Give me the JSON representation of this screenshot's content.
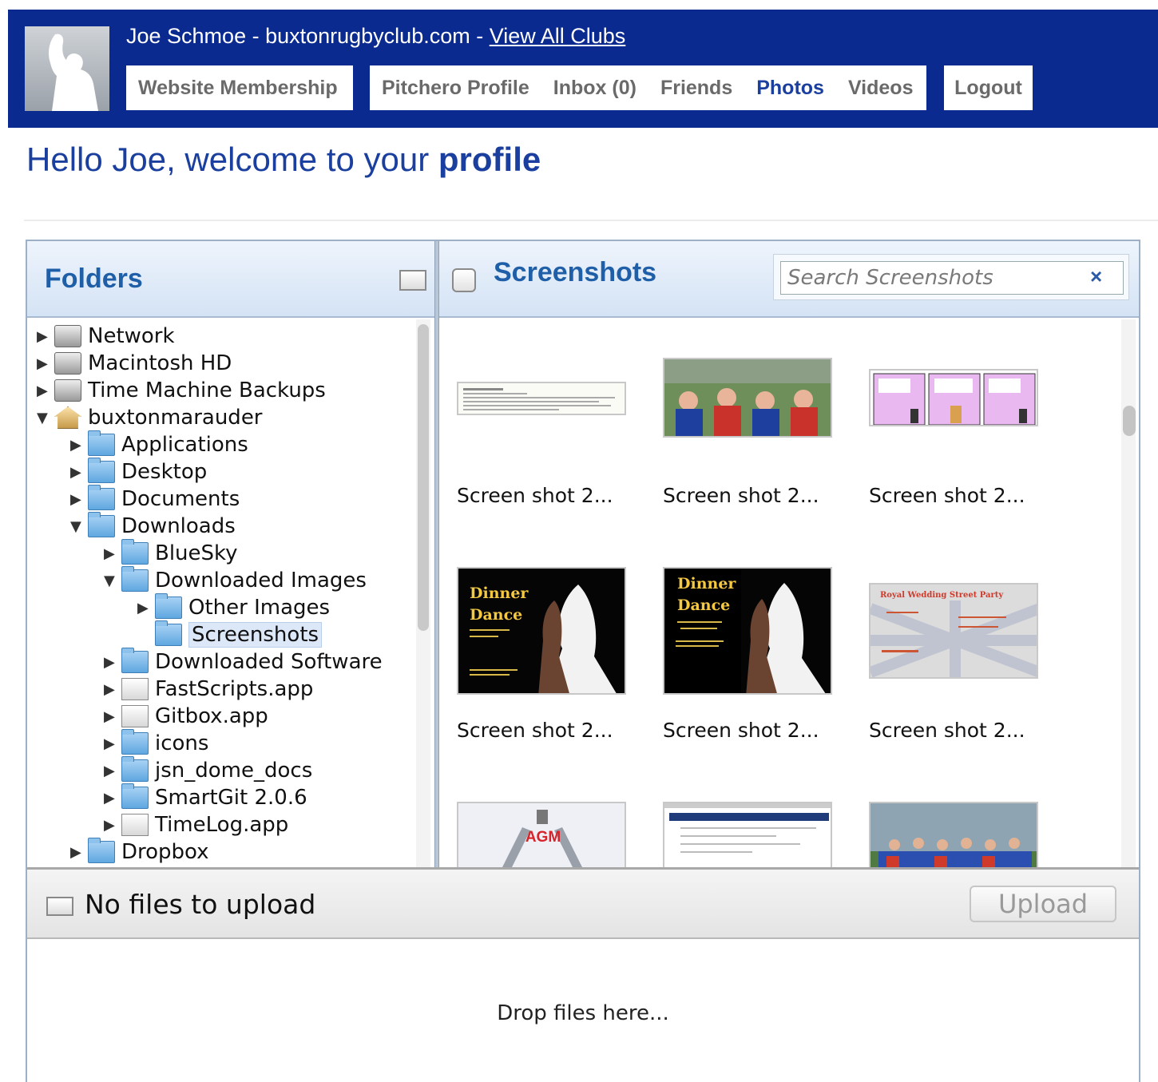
{
  "header": {
    "user_site": "Joe Schmoe - buxtonrugbyclub.com - ",
    "view_all_clubs": "View All Clubs",
    "nav": {
      "membership": "Website Membership",
      "profile": "Pitchero Profile",
      "inbox": "Inbox (0)",
      "friends": "Friends",
      "photos": "Photos",
      "videos": "Videos",
      "logout": "Logout"
    },
    "active_nav": "Photos",
    "brand_color": "#0a2a8f"
  },
  "greeting": {
    "text": "Hello Joe, welcome to your ",
    "bold": "profile"
  },
  "folders": {
    "title": "Folders",
    "tree": [
      {
        "label": "Network",
        "icon": "network-icon",
        "expanded": false
      },
      {
        "label": "Macintosh HD",
        "icon": "hard-drive-icon",
        "expanded": false
      },
      {
        "label": "Time Machine Backups",
        "icon": "time-machine-icon",
        "expanded": false
      },
      {
        "label": "buxtonmarauder",
        "icon": "home-icon",
        "expanded": true
      },
      {
        "label": "Applications",
        "icon": "applications-folder-icon",
        "expanded": false
      },
      {
        "label": "Desktop",
        "icon": "desktop-folder-icon",
        "expanded": false
      },
      {
        "label": "Documents",
        "icon": "documents-folder-icon",
        "expanded": false
      },
      {
        "label": "Downloads",
        "icon": "downloads-folder-icon",
        "expanded": true
      },
      {
        "label": "BlueSky",
        "icon": "folder-icon",
        "expanded": false
      },
      {
        "label": "Downloaded Images",
        "icon": "folder-icon",
        "expanded": true
      },
      {
        "label": "Other Images",
        "icon": "folder-icon",
        "expanded": false
      },
      {
        "label": "Screenshots",
        "icon": "folder-icon",
        "selected": true
      },
      {
        "label": "Downloaded Software",
        "icon": "folder-icon",
        "expanded": false
      },
      {
        "label": "FastScripts.app",
        "icon": "fastscripts-app-icon",
        "expanded": false
      },
      {
        "label": "Gitbox.app",
        "icon": "gitbox-app-icon",
        "expanded": false
      },
      {
        "label": "icons",
        "icon": "folder-icon",
        "expanded": false
      },
      {
        "label": "jsn_dome_docs",
        "icon": "folder-icon",
        "expanded": false
      },
      {
        "label": "SmartGit 2.0.6",
        "icon": "folder-icon",
        "expanded": false
      },
      {
        "label": "TimeLog.app",
        "icon": "timelog-app-icon",
        "expanded": false
      },
      {
        "label": "Dropbox",
        "icon": "dropbox-folder-icon",
        "expanded": false
      }
    ]
  },
  "screenshots": {
    "title": "Screenshots",
    "search_placeholder": "Search Screenshots",
    "clear_symbol": "×",
    "items": [
      {
        "caption": "Screen shot 2...",
        "thumb": "document"
      },
      {
        "caption": "Screen shot 2...",
        "thumb": "team-photo"
      },
      {
        "caption": "Screen shot 2...",
        "thumb": "comic-strip"
      },
      {
        "caption": "Screen shot 2...",
        "thumb": "poster",
        "poster_title": "Dinner Dance"
      },
      {
        "caption": "Screen shot 2...",
        "thumb": "poster",
        "poster_title": "Dinner Dance"
      },
      {
        "caption": "Screen shot 2...",
        "thumb": "flyer",
        "flyer_title": "Royal Wedding Street Party"
      },
      {
        "caption": "",
        "thumb": "agm",
        "agm_title": "AGM"
      },
      {
        "caption": "",
        "thumb": "webpage"
      },
      {
        "caption": "",
        "thumb": "team-photo-2"
      }
    ]
  },
  "upload": {
    "status": "No files to upload",
    "button": "Upload",
    "drop_text": "Drop files here..."
  }
}
